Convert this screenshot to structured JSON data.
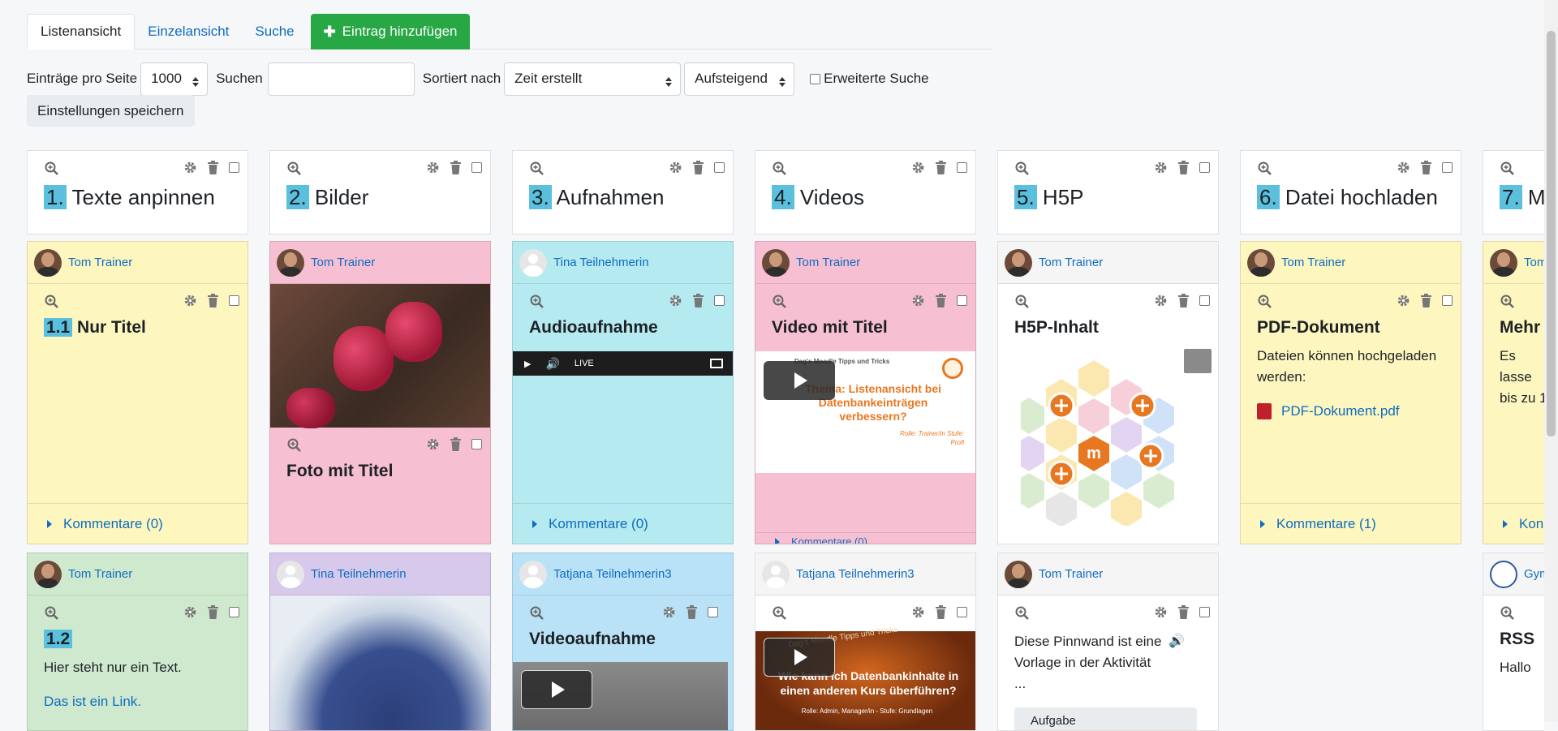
{
  "tabs": [
    {
      "label": "Listenansicht"
    },
    {
      "label": "Einzelansicht"
    },
    {
      "label": "Suche"
    },
    {
      "label": "Eintrag hinzufügen"
    }
  ],
  "controls": {
    "per_page_label": "Einträge pro Seite",
    "per_page_value": "1000",
    "search_label": "Suchen",
    "search_value": "",
    "sort_label": "Sortiert nach",
    "sort_value": "Zeit erstellt",
    "order_value": "Aufsteigend",
    "advanced_label": "Erweiterte Suche",
    "save_label": "Einstellungen speichern"
  },
  "columns": [
    {
      "num": "1.",
      "title": "Texte anpinnen"
    },
    {
      "num": "2.",
      "title": "Bilder"
    },
    {
      "num": "3.",
      "title": "Aufnahmen"
    },
    {
      "num": "4.",
      "title": "Videos"
    },
    {
      "num": "5.",
      "title": "H5P"
    },
    {
      "num": "6.",
      "title": "Datei hochladen"
    },
    {
      "num": "7.",
      "title": "M"
    }
  ],
  "cards": {
    "c1a": {
      "author": "Tom Trainer",
      "num": "1.1",
      "title": "Nur Titel",
      "comments": "Kommentare (0)"
    },
    "c1b": {
      "author": "Tom Trainer",
      "num": "1.2",
      "text": "Hier steht nur ein Text.",
      "link": "Das ist ein Link."
    },
    "c2a": {
      "author": "Tom Trainer",
      "title": "Foto mit Titel"
    },
    "c2b": {
      "author": "Tina Teilnehmerin"
    },
    "c3a": {
      "author": "Tina Teilnehmerin",
      "title": "Audioaufnahme",
      "live": "LIVE",
      "comments": "Kommentare (0)"
    },
    "c3b": {
      "author": "Tatjana Teilnehmerin3",
      "title": "Videoaufnahme"
    },
    "c4a": {
      "author": "Tom Trainer",
      "title": "Video mit Titel",
      "v_top": "Dag's Moodle Tipps und Tricks",
      "v_main": "Thema: Listenansicht bei Datenbankeinträgen verbessern?",
      "v_foot": "Rolle: Trainer/in Stufe: Profi",
      "comments": "Kommentare (0)"
    },
    "c4b": {
      "author": "Tatjana Teilnehmerin3",
      "v_top": "Dag's Moodle Tipps und Tricks",
      "v_main": "Wie kann ich Datenbankinhalte in einen anderen Kurs überführen?",
      "v_foot": "Rolle: Admin, Manager/in - Stufe: Grundlagen"
    },
    "c5a": {
      "author": "Tom Trainer",
      "title": "H5P-Inhalt"
    },
    "c5b": {
      "author": "Tom Trainer",
      "text": "Diese Pinnwand ist eine Vorlage in der Aktivität",
      "ellipsis": "...",
      "button": "Aufgabe"
    },
    "c6a": {
      "author": "Tom Trainer",
      "title": "PDF-Dokument",
      "text": "Dateien können hochgeladen werden:",
      "file": "PDF-Dokument.pdf",
      "comments": "Kommentare (1)"
    },
    "c7a": {
      "author": "Tom",
      "title": "Mehr",
      "text": "Es lasse bis zu 1",
      "comments": "Kon"
    },
    "c7b": {
      "author": "Gym",
      "title": "RSS",
      "text": "Hallo"
    }
  },
  "colors": {
    "yellow": "#fdf7bf",
    "pink": "#f7c0d2",
    "cyan": "#b4eaf0",
    "green": "#cfe9cf",
    "purple": "#d6c9ec",
    "blue": "#b9e2f7",
    "accent": "#5bc0de",
    "link": "#0f6cbf",
    "add": "#28a745"
  }
}
